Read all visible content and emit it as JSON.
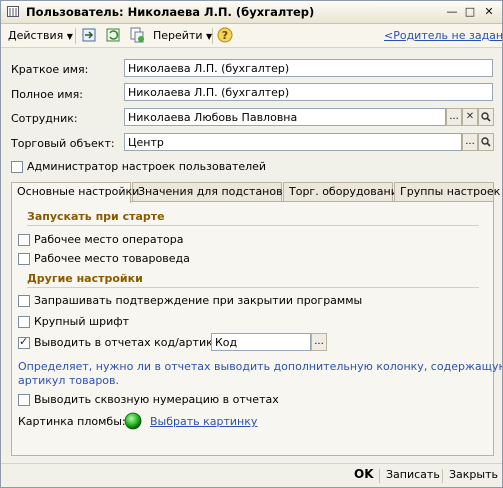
{
  "window": {
    "title": "Пользователь: Николаева Л.П. (бухгалтер)"
  },
  "toolbar": {
    "actions_label": "Действия",
    "goto_label": "Перейти",
    "parent_link": "<Родитель не задан>"
  },
  "form": {
    "short_name": {
      "label": "Краткое имя:",
      "value": "Николаева Л.П. (бухгалтер)"
    },
    "full_name": {
      "label": "Полное имя:",
      "value": "Николаева Л.П. (бухгалтер)"
    },
    "employee": {
      "label": "Сотрудник:",
      "value": "Николаева Любовь Павловна"
    },
    "trade_object": {
      "label": "Торговый объект:",
      "value": "Центр"
    },
    "admin_checkbox": {
      "label": "Администратор настроек пользователей",
      "checked": false
    }
  },
  "tabs": [
    {
      "label": "Основные настройки"
    },
    {
      "label": "Значения для подстановки"
    },
    {
      "label": "Торг. оборудование"
    },
    {
      "label": "Группы настроек"
    }
  ],
  "main": {
    "startup_heading": "Запускать при старте",
    "operator_workplace": "Рабочее место оператора",
    "merchandiser_workplace": "Рабочее место товароведа",
    "other_heading": "Другие настройки",
    "confirm_close": "Запрашивать подтверждение при закрытии программы",
    "large_font": "Крупный шрифт",
    "show_code_label": "Выводить в отчетах код/артикул:",
    "show_code_value": "Код",
    "hint_line1": "Определяет, нужно ли в отчетах выводить дополнительную колонку, содержащую код или",
    "hint_line2": "артикул товаров.",
    "through_numbering": "Выводить сквозную нумерацию в отчетах",
    "seal_picture_label": "Картинка пломбы:",
    "choose_picture_link": "Выбрать картинку"
  },
  "bottom": {
    "ok": "OK",
    "save": "Записать",
    "close": "Закрыть"
  },
  "colors": {
    "section_heading": "#8a5a00",
    "link": "#2b50b0",
    "seal_indicator": "#2fbf2f"
  }
}
